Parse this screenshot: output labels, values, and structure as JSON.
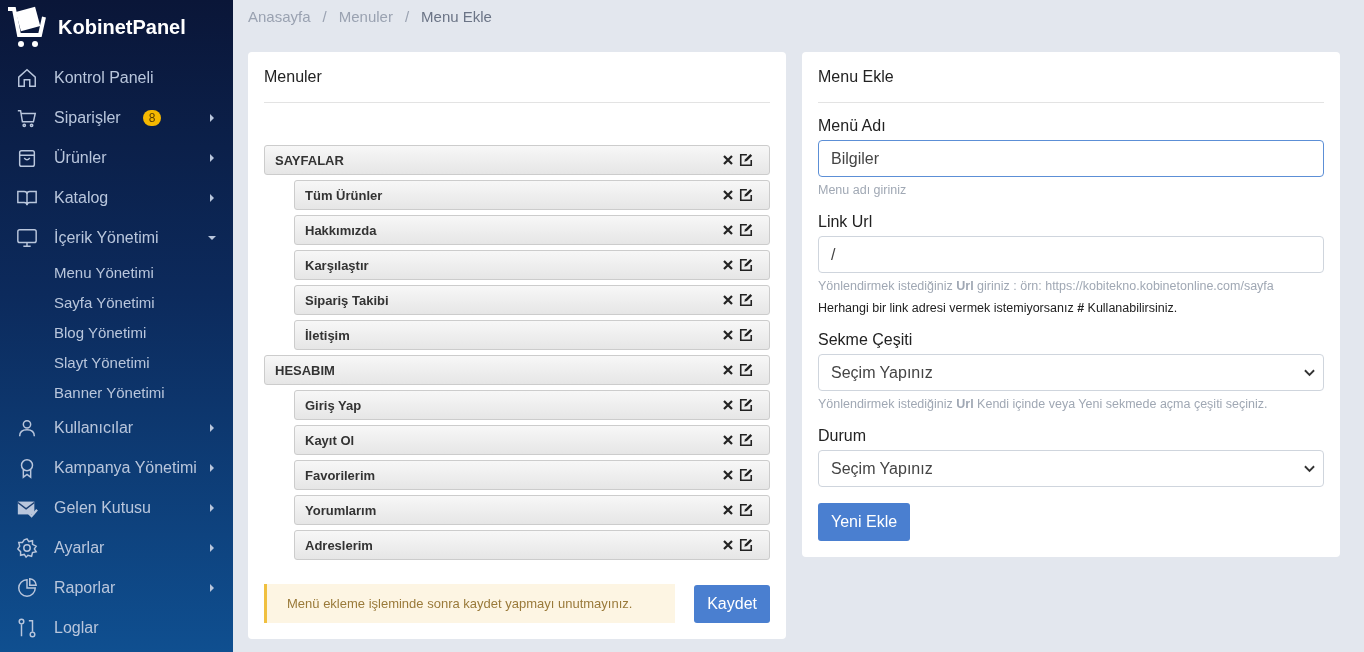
{
  "sidebar": {
    "brand": "KobinetPanel",
    "items": [
      {
        "label": "Kontrol Paneli",
        "kind": "link"
      },
      {
        "label": "Siparişler",
        "kind": "group",
        "expanded": false,
        "badge": "8"
      },
      {
        "label": "Ürünler",
        "kind": "group",
        "expanded": false
      },
      {
        "label": "Katalog",
        "kind": "group",
        "expanded": false
      },
      {
        "label": "İçerik Yönetimi",
        "kind": "group",
        "expanded": true,
        "children": [
          "Menu Yönetimi",
          "Sayfa Yönetimi",
          "Blog Yönetimi",
          "Slayt Yönetimi",
          "Banner Yönetimi"
        ]
      },
      {
        "label": "Kullanıcılar",
        "kind": "group",
        "expanded": false
      },
      {
        "label": "Kampanya Yönetimi",
        "kind": "group",
        "expanded": false
      },
      {
        "label": "Gelen Kutusu",
        "kind": "group",
        "expanded": false
      },
      {
        "label": "Ayarlar",
        "kind": "group",
        "expanded": false
      },
      {
        "label": "Raporlar",
        "kind": "group",
        "expanded": false
      },
      {
        "label": "Loglar",
        "kind": "link"
      }
    ]
  },
  "breadcrumb": {
    "separator": "/",
    "items": [
      "Anasayfa",
      "Menuler",
      "Menu Ekle"
    ]
  },
  "menus_card": {
    "title": "Menuler",
    "tree": [
      {
        "label": "SAYFALAR",
        "children": [
          {
            "label": "Tüm Ürünler"
          },
          {
            "label": "Hakkımızda"
          },
          {
            "label": "Karşılaştır"
          },
          {
            "label": "Sipariş Takibi"
          },
          {
            "label": "İletişim"
          }
        ]
      },
      {
        "label": "HESABIM",
        "children": [
          {
            "label": "Giriş Yap"
          },
          {
            "label": "Kayıt Ol"
          },
          {
            "label": "Favorilerim"
          },
          {
            "label": "Yorumlarım"
          },
          {
            "label": "Adreslerim"
          }
        ]
      }
    ],
    "alert": "Menü ekleme işleminde sonra kaydet yapmayı unutmayınız.",
    "save_button": "Kaydet"
  },
  "form_card": {
    "title": "Menu Ekle",
    "fields": [
      {
        "label": "Menü Adı",
        "kind": "text",
        "value": "Bilgiler",
        "focused": true,
        "help": [
          {
            "text": "Menu adı giriniz",
            "kind": "muted"
          }
        ]
      },
      {
        "label": "Link Url",
        "kind": "text",
        "value": "/",
        "focused": false,
        "help": [
          {
            "text": "Yönlendirmek istediğiniz **Url** giriniz : örn: https://kobitekno.kobinetonline.com/sayfa",
            "kind": "muted"
          },
          {
            "text": "Herhangi bir link adresi vermek istemiyorsanız **#** Kullanabilirsiniz.",
            "kind": "note"
          }
        ]
      },
      {
        "label": "Sekme Çeşiti",
        "kind": "select",
        "value": "Seçim Yapınız",
        "focused": false,
        "help": [
          {
            "text": "Yönlendirmek istediğiniz **Url** Kendi içinde veya Yeni sekmede açma çeşiti seçiniz.",
            "kind": "muted"
          }
        ]
      },
      {
        "label": "Durum",
        "kind": "select",
        "value": "Seçim Yapınız",
        "focused": false
      }
    ],
    "submit_button": "Yeni Ekle"
  }
}
